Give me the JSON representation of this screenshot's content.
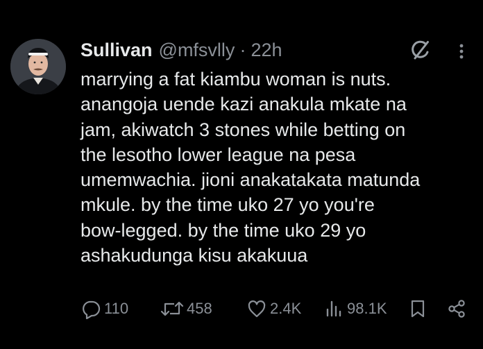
{
  "author": {
    "display_name": "Sullivan",
    "handle": "@mfsvlly",
    "separator": "·",
    "time": "22h"
  },
  "tweet": {
    "lines": [
      "marrying a fat kiambu woman is nuts.",
      "anangoja uende kazi anakula mkate na",
      "jam, akiwatch 3 stones while betting on",
      "the lesotho lower league na pesa",
      "umemwachia. jioni anakatakata matunda",
      "mkule. by the time uko 27 yo you're",
      "bow-legged. by the time uko 29 yo",
      "ashakudunga kisu akakuua"
    ]
  },
  "actions": {
    "replies": "110",
    "reposts": "458",
    "likes": "2.4K",
    "views": "98.1K"
  },
  "icons": {
    "avatar": "avatar",
    "grok": "grok-icon",
    "more": "more-icon",
    "reply": "reply-icon",
    "repost": "repost-icon",
    "like": "like-icon",
    "views": "views-icon",
    "bookmark": "bookmark-icon",
    "share": "share-icon"
  },
  "colors": {
    "background": "#000000",
    "primary_text": "#e7e9ea",
    "secondary_text": "#8b9097"
  }
}
